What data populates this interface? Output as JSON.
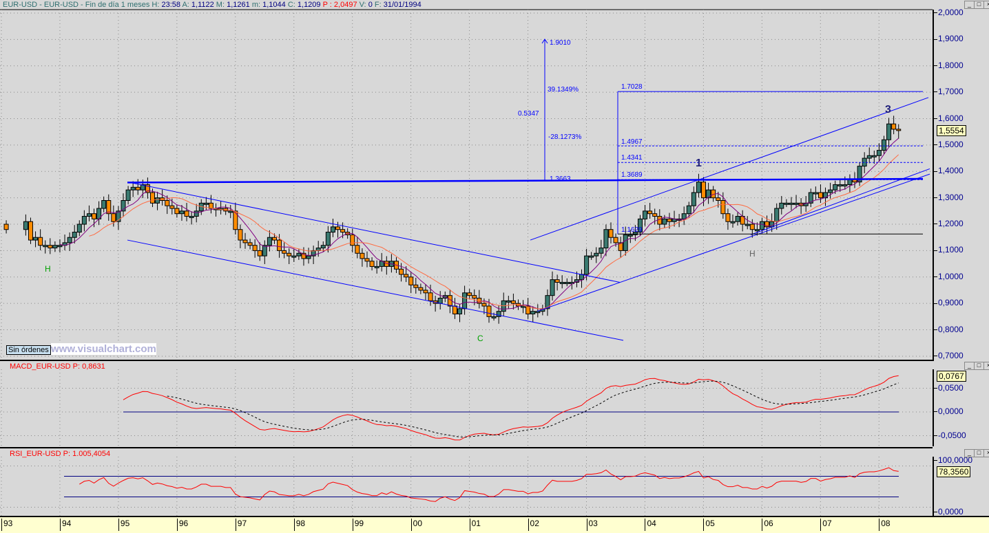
{
  "header": {
    "symbol": "EUR-USD - EUR-USD - Fin de día 1 meses",
    "h_label": "H:",
    "h": "23:58",
    "a_label": "A:",
    "a": "1,1122",
    "m_label": "M:",
    "m": "1,1261",
    "mn_label": "m:",
    "mn": "1,1044",
    "c_label": "C:",
    "c": "1,1209",
    "p": "P : 2,0497",
    "v_label": "V:",
    "v": "0",
    "f_label": "F:",
    "f": "31/01/1994"
  },
  "price_axis": {
    "ticks": [
      "2,0000",
      "1,9000",
      "1,8000",
      "1,7000",
      "1,6000",
      "1,5000",
      "1,4000",
      "1,3000",
      "1,2000",
      "1,1000",
      "1,0000",
      "0,9000",
      "0,8000",
      "0,7000"
    ],
    "current": "1,5554"
  },
  "macd": {
    "title": "MACD_EUR-USD  P: 0,8631",
    "ticks": [
      "0,0500",
      "0,0000",
      "-0,0500"
    ],
    "current": "0,0767"
  },
  "rsi": {
    "title": "RSI_EUR-USD  P: 1.005,4054",
    "ticks": [
      "100,0000",
      "0,0000"
    ],
    "current": "78,3560"
  },
  "time_axis": [
    "93",
    "94",
    "95",
    "96",
    "97",
    "98",
    "99",
    "00",
    "01",
    "02",
    "03",
    "04",
    "05",
    "06",
    "07",
    "08"
  ],
  "sin_ordenes": "Sin órdenes",
  "watermark": "www.visualchart.com",
  "annotations": {
    "top": "1.9010",
    "pct_up": "39.1349%",
    "range": "0.5347",
    "pct_down": "-28.1273%",
    "base": "1.3663",
    "t1": "1.7028",
    "t2": "1.4967",
    "t3": "1.4341",
    "t4": "1.3689",
    "t5": "1.1629",
    "wave1": "1",
    "wave3": "3",
    "h1": "H",
    "c": "C",
    "h2": "H"
  },
  "window_buttons": [
    "_",
    "□",
    "×"
  ],
  "colors": {
    "bull": "#3a7a70",
    "bear": "#ff8c00",
    "lines": "#0000ff",
    "ma_fast": "#800080",
    "ma_slow": "#ff6a40",
    "macd": "#ff0000",
    "rsi": "#ff0000"
  },
  "chart_data": {
    "type": "candlestick",
    "title": "EUR-USD monthly",
    "start": "1993-02",
    "closes": [
      1.18,
      null,
      null,
      null,
      1.21,
      1.14,
      1.15,
      1.12,
      1.12,
      1.11,
      1.12,
      1.12,
      1.13,
      1.15,
      1.17,
      1.2,
      1.23,
      1.24,
      1.22,
      1.26,
      1.29,
      1.24,
      1.21,
      1.25,
      1.29,
      1.33,
      1.34,
      1.33,
      1.35,
      1.32,
      1.28,
      1.3,
      1.29,
      1.27,
      1.26,
      1.24,
      1.25,
      1.23,
      1.23,
      1.25,
      1.28,
      1.28,
      1.26,
      1.26,
      1.26,
      1.25,
      1.25,
      1.18,
      1.14,
      1.13,
      1.12,
      1.1,
      1.08,
      1.12,
      1.15,
      1.14,
      1.1,
      1.09,
      1.08,
      1.08,
      1.09,
      1.07,
      1.08,
      1.1,
      1.11,
      1.12,
      1.17,
      1.19,
      1.18,
      1.17,
      1.16,
      1.12,
      1.09,
      1.07,
      1.06,
      1.04,
      1.04,
      1.06,
      1.04,
      1.06,
      1.03,
      1.01,
      1.0,
      0.97,
      0.96,
      0.95,
      0.94,
      0.91,
      0.9,
      0.92,
      0.93,
      0.89,
      0.86,
      0.88,
      0.94,
      0.93,
      0.92,
      0.9,
      0.89,
      0.85,
      0.85,
      0.87,
      0.91,
      0.91,
      0.9,
      0.89,
      0.89,
      0.86,
      0.87,
      0.87,
      0.88,
      0.93,
      0.99,
      0.98,
      0.98,
      0.98,
      0.98,
      0.99,
      1.01,
      1.08,
      1.08,
      1.09,
      1.11,
      1.18,
      1.15,
      1.13,
      1.1,
      1.16,
      1.16,
      1.17,
      1.22,
      1.25,
      1.24,
      1.23,
      1.2,
      1.22,
      1.21,
      1.22,
      1.22,
      1.24,
      1.27,
      1.32,
      1.36,
      1.3,
      1.33,
      1.3,
      1.29,
      1.24,
      1.21,
      1.21,
      1.23,
      1.2,
      1.2,
      1.18,
      1.18,
      1.21,
      1.19,
      1.21,
      1.26,
      1.28,
      1.28,
      1.28,
      1.28,
      1.27,
      1.28,
      1.32,
      1.32,
      1.3,
      1.32,
      1.33,
      1.35,
      1.35,
      1.35,
      1.37,
      1.36,
      1.42,
      1.45,
      1.46,
      1.46,
      1.48,
      1.52,
      1.58,
      1.56,
      1.555
    ],
    "ylim": [
      0.7,
      2.0
    ],
    "macd_ylim": [
      -0.07,
      0.09
    ],
    "rsi_ylim": [
      0,
      100
    ],
    "rsi_levels": [
      70,
      30
    ]
  }
}
